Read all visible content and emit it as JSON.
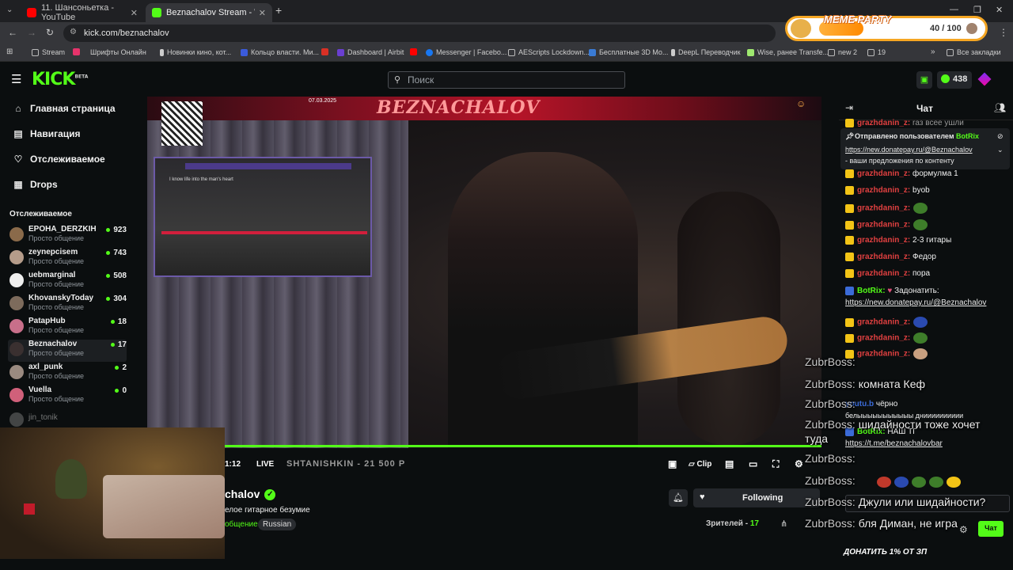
{
  "browser": {
    "tabs": [
      {
        "title": "11. Шансоньетка - YouTube",
        "color": "#ff0000"
      },
      {
        "title": "Beznachalov Stream - Watch L",
        "color": "#53fc18"
      }
    ],
    "url": "kick.com/beznachalov",
    "bookmarks": [
      "Stream",
      "Шрифты Онлайн",
      "Новинки кино, кот...",
      "Кольцо власти. Ми...",
      "Dashboard | Airbit",
      "Messenger | Facebo...",
      "AEScripts Lockdown...",
      "Бесплатные 3D Mo...",
      "DeepL Переводчик",
      "Wise, ранее Transfe...",
      "new 2",
      "19",
      "Все закладки"
    ]
  },
  "header": {
    "logo": "KICK",
    "logo_sup": "BETA",
    "search_placeholder": "Поиск",
    "points": "438"
  },
  "meme": {
    "label": "MEME PARTY",
    "count": "40 / 100",
    "progress": 0.4
  },
  "sidebar": {
    "nav": [
      {
        "label": "Главная страница",
        "icon": "home-icon"
      },
      {
        "label": "Навигация",
        "icon": "browse-icon"
      },
      {
        "label": "Отслеживаемое",
        "icon": "heart-icon"
      },
      {
        "label": "Drops",
        "icon": "drops-icon"
      }
    ],
    "following_title": "Отслеживаемое",
    "following": [
      {
        "name": "EPOHA_DERZKIH",
        "category": "Просто общение",
        "viewers": "923"
      },
      {
        "name": "zeynepcisem",
        "category": "Просто общение",
        "viewers": "743"
      },
      {
        "name": "uebmarginal",
        "category": "Просто общение",
        "viewers": "508"
      },
      {
        "name": "KhovanskyToday",
        "category": "Просто общение",
        "viewers": "304"
      },
      {
        "name": "PatapHub",
        "category": "Просто общение",
        "viewers": "18"
      },
      {
        "name": "Beznachalov",
        "category": "Просто общение",
        "viewers": "17"
      },
      {
        "name": "axl_punk",
        "category": "Просто общение",
        "viewers": "2"
      },
      {
        "name": "Vuella",
        "category": "Просто общение",
        "viewers": "0"
      },
      {
        "name": "jin_tonik",
        "category": "",
        "viewers": ""
      }
    ]
  },
  "video": {
    "banner": "BEZNACHALOV",
    "date": "07.03.2025",
    "time_elapsed": "1:12",
    "live": "LIVE",
    "ticker": "SHTANISHKIN - 21 500 P",
    "clip": "Clip",
    "game_lyric": "I know life into the man's heart"
  },
  "stream": {
    "name": "chalov",
    "title": "елое гитарное безумие",
    "category": "общение",
    "language": "Russian",
    "following_label": "Following",
    "viewers_label": "Зрителей",
    "viewers": "17"
  },
  "chat": {
    "title": "Чат",
    "pinned_by": "Отправлено пользователем",
    "pinned_user": "BotRix",
    "pinned_link": "https://new.donatepay.ru/@Beznachalov",
    "pinned_text": " - ваши предложения по контенту",
    "top_line": "raз всее ушли",
    "messages": [
      {
        "user": "grazhdanin_z:",
        "text": "формулма 1"
      },
      {
        "user": "grazhdanin_z:",
        "text": "byob"
      },
      {
        "user": "grazhdanin_z:",
        "text": ""
      },
      {
        "user": "grazhdanin_z:",
        "text": ""
      },
      {
        "user": "grazhdanin_z:",
        "text": "2-3 гитары"
      },
      {
        "user": "grazhdanin_z:",
        "text": "Федор"
      },
      {
        "user": "grazhdanin_z:",
        "text": "пора"
      }
    ],
    "bot_user": "BotRix:",
    "bot_text": "Задонатить:",
    "bot_link": "https://new.donatepay.ru/@Beznachalov",
    "more_users": [
      "grazhdanin_z:",
      "grazhdanin_z:",
      "grazhdanin_z:"
    ],
    "youtu": "youtu.b",
    "youtu_tail": "чёрно",
    "long_line": "белыыыыыыыыыыы днииииииииии",
    "bot2_text": "НАШ ТГ",
    "tg_link": "https://t.me/beznachalovbar",
    "chat_button": "Чат",
    "donate_banner": "ДОНАТИТЬ 1% ОТ ЗП"
  },
  "overlay_chat": [
    {
      "user": "ZubrBoss:",
      "text": ""
    },
    {
      "user": "ZubrBoss:",
      "text": "комната Кеф"
    },
    {
      "user": "ZubrBoss:",
      "text": ""
    },
    {
      "user": "ZubrBoss:",
      "text": "шидайности тоже хочет"
    },
    {
      "user": "",
      "text": "туда"
    },
    {
      "user": "ZubrBoss:",
      "text": ""
    },
    {
      "user": "ZubrBoss:",
      "text": ""
    },
    {
      "user": "ZubrBoss:",
      "text": "Джули или шидайности?"
    },
    {
      "user": "ZubrBoss:",
      "text": "бля Диман, не игра"
    }
  ]
}
